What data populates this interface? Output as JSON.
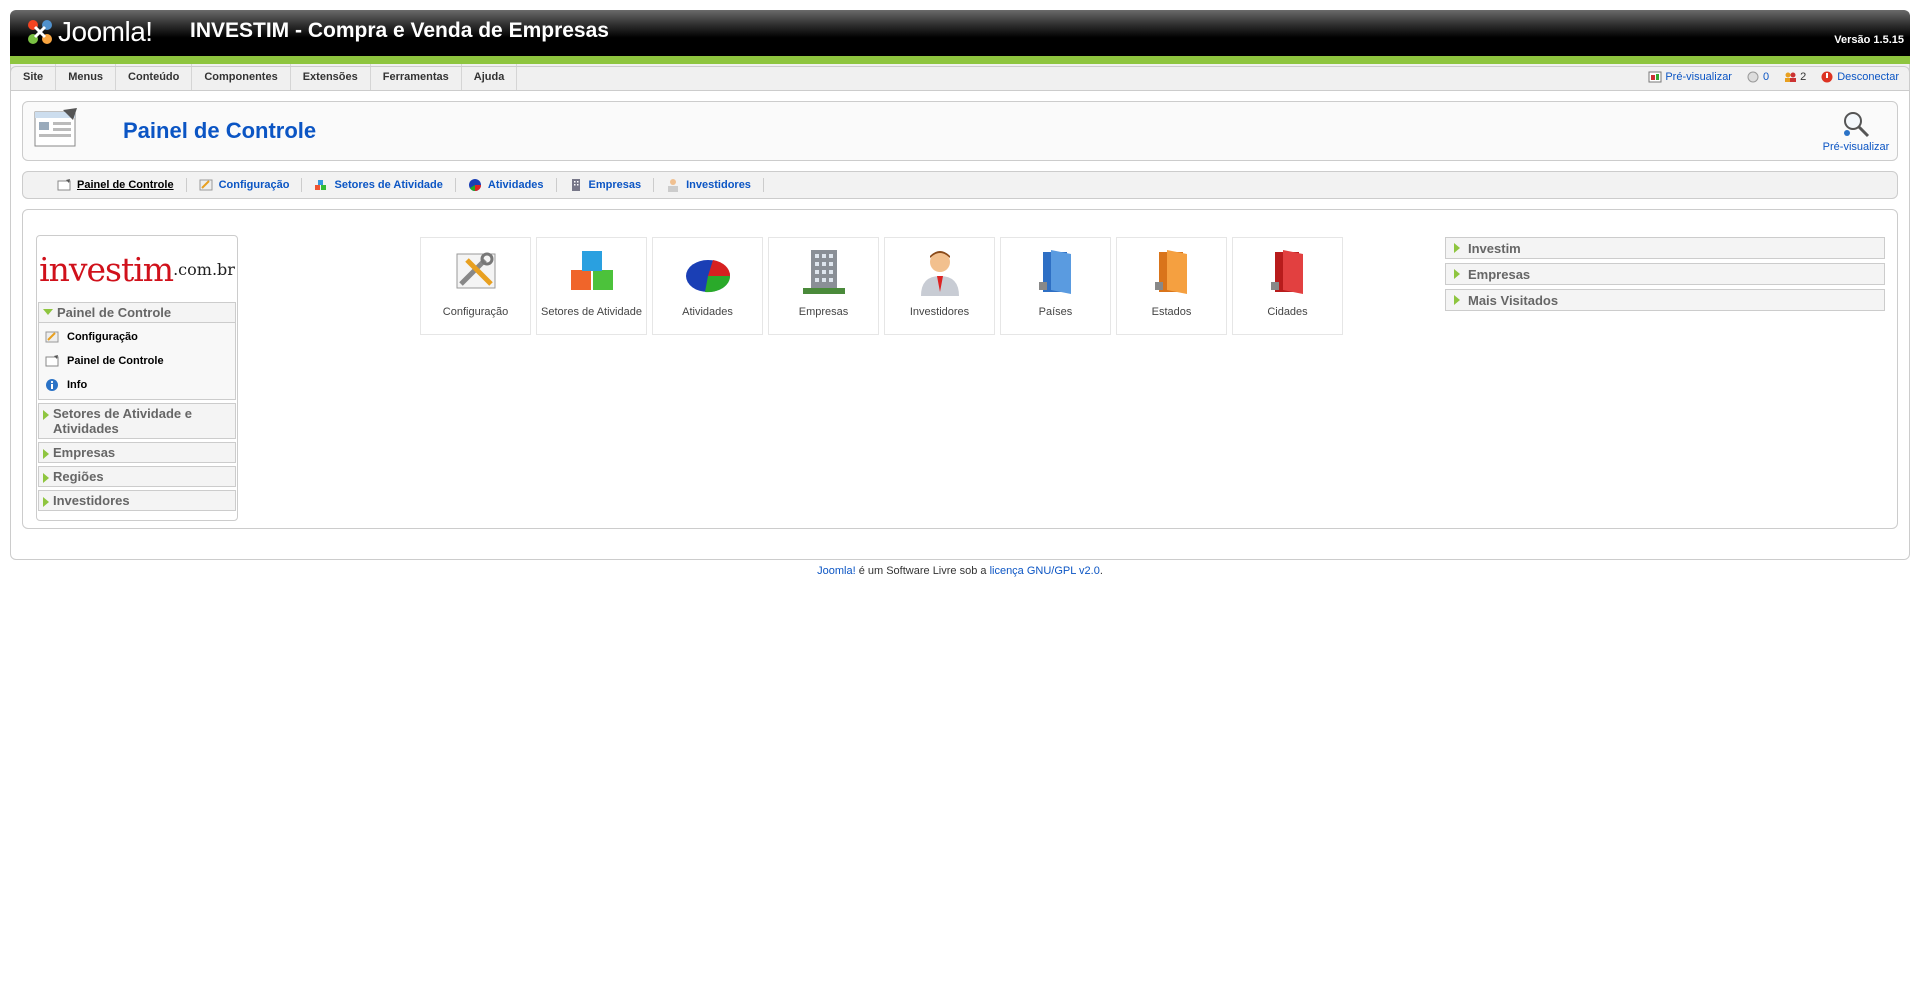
{
  "header": {
    "logo_text": "Joomla!",
    "site_title": "INVESTIM - Compra e Venda de Empresas",
    "version": "Versão 1.5.15"
  },
  "menu": {
    "items": [
      "Site",
      "Menus",
      "Conteúdo",
      "Componentes",
      "Extensões",
      "Ferramentas",
      "Ajuda"
    ],
    "status": {
      "preview": "Pré-visualizar",
      "messages": "0",
      "users": "2",
      "logout": "Desconectar"
    }
  },
  "page": {
    "title": "Painel de Controle",
    "preview_label": "Pré-visualizar"
  },
  "submenu": {
    "items": [
      "Painel de Controle",
      "Configuração",
      "Setores de Atividade",
      "Atividades",
      "Empresas",
      "Investidores"
    ]
  },
  "left": {
    "brand_main": "investim",
    "brand_suffix": ".com.br",
    "sections": [
      {
        "label": "Painel de Controle",
        "items": [
          "Configuração",
          "Painel de Controle",
          "Info"
        ]
      },
      {
        "label": "Setores de Atividade e Atividades"
      },
      {
        "label": "Empresas"
      },
      {
        "label": "Regiões"
      },
      {
        "label": "Investidores"
      }
    ]
  },
  "icons": [
    "Configuração",
    "Setores de Atividade",
    "Atividades",
    "Empresas",
    "Investidores",
    "Países",
    "Estados",
    "Cidades"
  ],
  "right": {
    "panels": [
      "Investim",
      "Empresas",
      "Mais Visitados"
    ]
  },
  "footer": {
    "link1": "Joomla!",
    "text": " é um Software Livre sob a ",
    "link2": "licença GNU/GPL v2.0",
    "end": "."
  },
  "colors": {
    "accent_green": "#8ec53f",
    "link_blue": "#0b55c4",
    "brand_red": "#d0111b"
  }
}
